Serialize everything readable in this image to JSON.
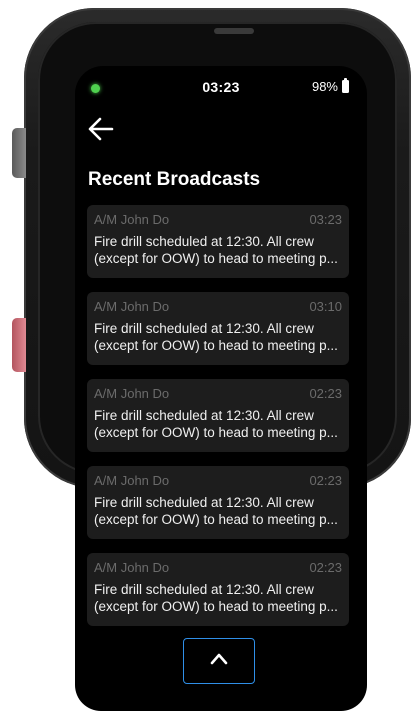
{
  "status_bar": {
    "time": "03:23",
    "battery": "98%",
    "indicator_color": "#4fd14f"
  },
  "header": {
    "back_icon": "arrow-left-icon",
    "title": "Recent Broadcasts"
  },
  "broadcasts": [
    {
      "sender": "A/M John Do",
      "time": "03:23",
      "line1": "Fire drill scheduled at 12:30. All crew",
      "line2": "(except for OOW) to head to meeting p..."
    },
    {
      "sender": "A/M John Do",
      "time": "03:10",
      "line1": "Fire drill scheduled at 12:30. All crew",
      "line2": "(except for OOW) to head to meeting p..."
    },
    {
      "sender": "A/M John Do",
      "time": "02:23",
      "line1": "Fire drill scheduled at 12:30. All crew",
      "line2": "(except for OOW) to head to meeting p..."
    },
    {
      "sender": "A/M John Do",
      "time": "02:23",
      "line1": "Fire drill scheduled at 12:30. All crew",
      "line2": "(except for OOW) to head to meeting p..."
    },
    {
      "sender": "A/M John Do",
      "time": "02:23",
      "line1": "Fire drill scheduled at 12:30. All crew",
      "line2": "(except for OOW) to head to meeting p..."
    }
  ],
  "footer": {
    "scroll_up_icon": "chevron-up-icon",
    "accent_color": "#2f8fe8"
  }
}
